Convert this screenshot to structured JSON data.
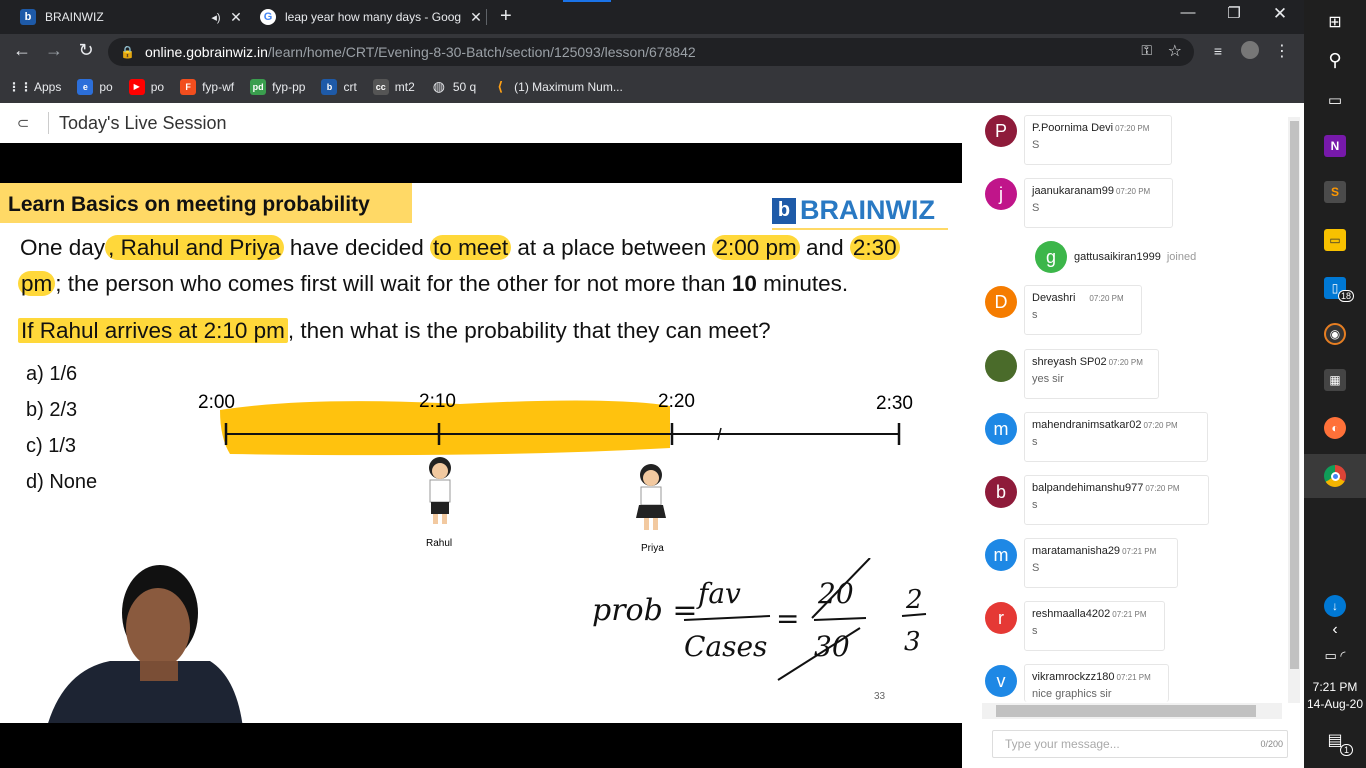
{
  "browser": {
    "tabs": [
      {
        "title": "BRAINWIZ",
        "icon": "brainwiz-favicon",
        "audio": true
      },
      {
        "title": "leap year how many days - Goog",
        "icon": "google-favicon"
      }
    ],
    "url_host": "online.gobrainwiz.in",
    "url_path": "/learn/home/CRT/Evening-8-30-Batch/section/125093/lesson/678842",
    "bookmarks": [
      {
        "label": "Apps",
        "icon": "apps-grid-icon",
        "color": "#e8eaed"
      },
      {
        "label": "po",
        "icon": "hackerearth-icon",
        "color": "#2c6fda"
      },
      {
        "label": "po",
        "icon": "youtube-icon",
        "color": "#ff0000"
      },
      {
        "label": "fyp-wf",
        "icon": "figma-icon",
        "color": "#f24e1e"
      },
      {
        "label": "fyp-pp",
        "icon": "pdf-icon",
        "color": "#3a9e4e"
      },
      {
        "label": "crt",
        "icon": "brainwiz-icon",
        "color": "#1e5aa8"
      },
      {
        "label": "mt2",
        "icon": "cc-icon",
        "color": "#555555"
      },
      {
        "label": "50 q",
        "icon": "globe-icon",
        "color": "#e8eaed"
      },
      {
        "label": "(1) Maximum Num...",
        "icon": "leetcode-icon",
        "color": "#ffa116"
      }
    ]
  },
  "page": {
    "header_title": "Today's Live Session"
  },
  "slide": {
    "heading": "Learn Basics on meeting probability",
    "logo": "BRAINWIZ",
    "question_line1_a": "One day",
    "question_line1_b": ", Rahul and Priya",
    "question_line1_c": " have decided ",
    "question_line1_d": "to meet",
    "question_line1_e": " at a place between ",
    "question_line1_f": "2:00 pm",
    "question_line1_g": " and ",
    "question_line1_h": "2:30",
    "question_line2_a": "pm",
    "question_line2_b": "; the person who comes first will wait for the other for not more than ",
    "question_line2_c": "10",
    "question_line2_d": " minutes.",
    "question_line3_a": "If Rahul arrives at 2:10 pm",
    "question_line3_b": ", then what is the probability that they can meet?",
    "options": [
      "a) 1/6",
      "b) 2/3",
      "c)  1/3",
      "d)  None"
    ],
    "timeline_labels": [
      "2:00",
      "2:10",
      "2:20",
      "2:30"
    ],
    "figures": [
      "Rahul",
      "Priya"
    ],
    "handwriting_prob": "prob =",
    "handwriting_num": "fav",
    "handwriting_den": "Cases",
    "handwriting_eq": "=",
    "handwriting_20": "20",
    "handwriting_30": "30",
    "handwriting_2": "2",
    "handwriting_3": "3",
    "page_number": "33"
  },
  "chat": {
    "messages": [
      {
        "avatar": "P",
        "color": "#8e1b3a",
        "name": "P.Poornima Devi",
        "time": "07:20 PM",
        "text": "S"
      },
      {
        "avatar": "j",
        "color": "#c0158a",
        "name": "jaanukaranam99",
        "time": "07:20 PM",
        "text": "S"
      },
      {
        "avatar": "D",
        "color": "#f57c00",
        "name": "Devashri",
        "time": "07:20 PM",
        "text": "s"
      },
      {
        "avatar": "",
        "color": "#4a6b2a",
        "name": "shreyash SP02",
        "time": "07:20 PM",
        "text": "yes sir"
      },
      {
        "avatar": "m",
        "color": "#1e88e5",
        "name": "mahendranimsatkar02",
        "time": "07:20 PM",
        "text": "s"
      },
      {
        "avatar": "b",
        "color": "#8e1b3a",
        "name": "balpandehimanshu977",
        "time": "07:20 PM",
        "text": "s"
      },
      {
        "avatar": "m",
        "color": "#1e88e5",
        "name": "maratamanisha29",
        "time": "07:21 PM",
        "text": "S"
      },
      {
        "avatar": "r",
        "color": "#e53935",
        "name": "reshmaalla4202",
        "time": "07:21 PM",
        "text": "s"
      },
      {
        "avatar": "v",
        "color": "#1e88e5",
        "name": "vikramrockzz180",
        "time": "07:21 PM",
        "text": "nice graphics sir"
      }
    ],
    "joined": {
      "avatar": "g",
      "name": "gattusaikiran1999",
      "text": "joined"
    },
    "input_placeholder": "Type your message...",
    "char_count": "0/200"
  },
  "taskbar": {
    "time": "7:21 PM",
    "date": "14-Aug-20",
    "badge_count": "18",
    "notif_count": "1"
  }
}
